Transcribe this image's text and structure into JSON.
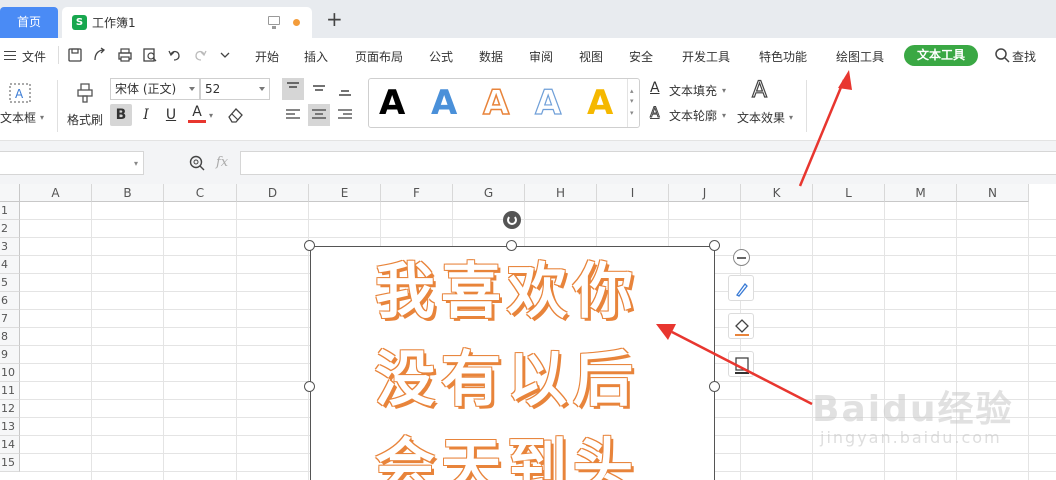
{
  "tabs": {
    "home": "首页",
    "doc": "工作簿1",
    "doc_icon": "S"
  },
  "menu": {
    "file": "文件",
    "items": [
      "开始",
      "插入",
      "页面布局",
      "公式",
      "数据",
      "审阅",
      "视图",
      "安全",
      "开发工具",
      "特色功能",
      "绘图工具"
    ],
    "active": "文本工具",
    "search": "查找"
  },
  "ribbon": {
    "textbox": "文本框",
    "format_painter": "格式刷",
    "font_name": "宋体 (正文)",
    "font_size": "52",
    "bold": "B",
    "italic": "I",
    "underline": "U",
    "font_color": "A",
    "preset_styles": [
      {
        "letter": "A",
        "color": "#000000",
        "style": "solid"
      },
      {
        "letter": "A",
        "color": "#4a90d9",
        "style": "solid"
      },
      {
        "letter": "A",
        "color": "#e8843b",
        "style": "outline"
      },
      {
        "letter": "A",
        "color": "#6f9fd8",
        "style": "outline"
      },
      {
        "letter": "A",
        "color": "#f5b800",
        "style": "solid"
      }
    ],
    "text_fill": "文本填充",
    "text_outline": "文本轮廓",
    "text_effects": "文本效果"
  },
  "formula_bar": {
    "fx": "fx",
    "name_box": "",
    "formula": ""
  },
  "columns": [
    "A",
    "B",
    "C",
    "D",
    "E",
    "F",
    "G",
    "H",
    "I",
    "J",
    "K",
    "L",
    "M",
    "N"
  ],
  "rows": [
    "1",
    "2",
    "3",
    "4",
    "5",
    "6",
    "7",
    "8",
    "9",
    "10",
    "11",
    "12",
    "13",
    "14",
    "15"
  ],
  "textbox_lines": [
    "我喜欢你",
    "没有以后",
    "会天到头"
  ],
  "watermark": {
    "brand": "Baidu经验",
    "url": "jingyan.baidu.com"
  },
  "colors": {
    "accent_green": "#3aa844",
    "home_tab": "#4a8bf5",
    "text_orange": "#e8843b",
    "arrow_red": "#e8362f"
  }
}
